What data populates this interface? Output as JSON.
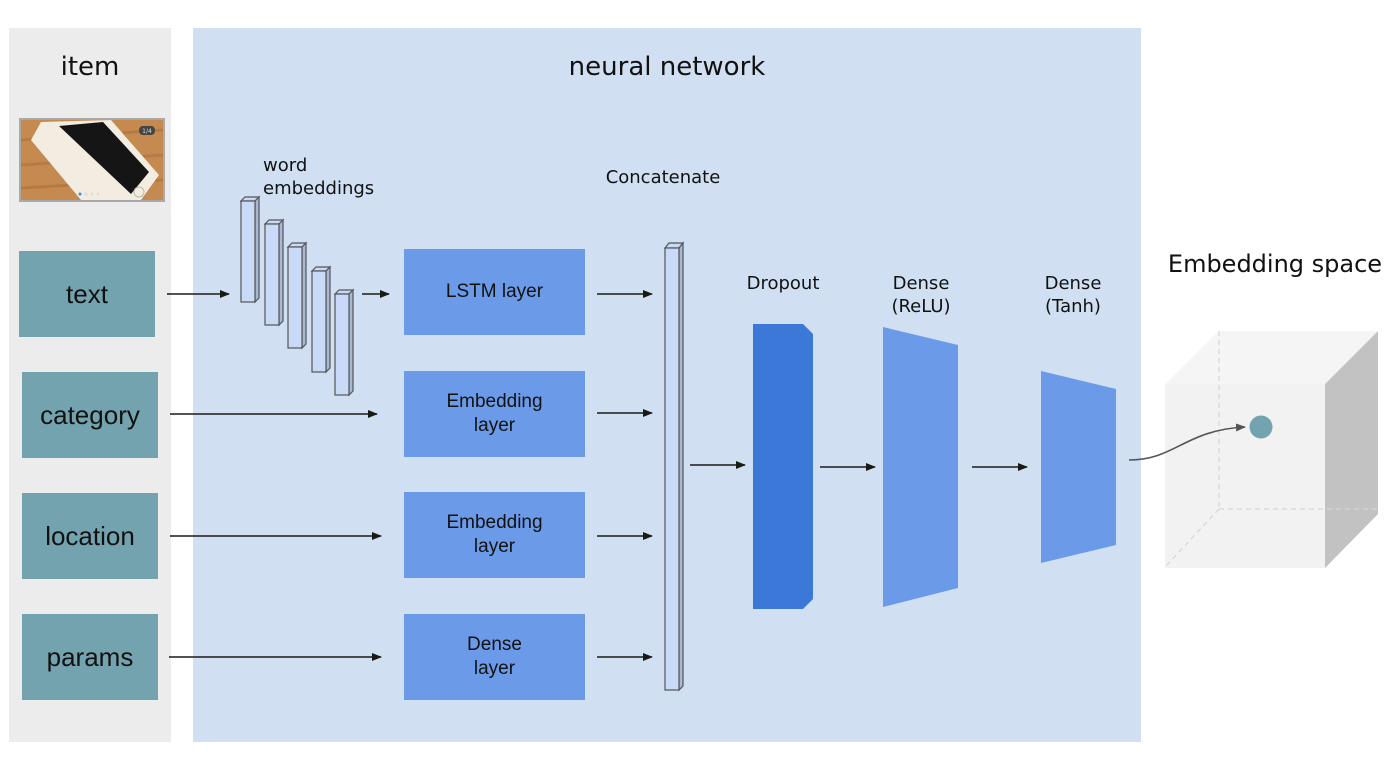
{
  "panels": {
    "item_title": "item",
    "network_title": "neural network",
    "embedding_space_title": "Embedding space"
  },
  "thumbnail": {
    "badge": "1/4",
    "carousel_dots": 4,
    "active_dot": 1
  },
  "inputs": [
    {
      "label": "text"
    },
    {
      "label": "category"
    },
    {
      "label": "location"
    },
    {
      "label": "params"
    }
  ],
  "word_embeddings_label_line1": "word",
  "word_embeddings_label_line2": "embeddings",
  "layers": [
    {
      "line1": "LSTM layer",
      "line2": ""
    },
    {
      "line1": "Embedding",
      "line2": "layer"
    },
    {
      "line1": "Embedding",
      "line2": "layer"
    },
    {
      "line1": "Dense",
      "line2": "layer"
    }
  ],
  "concatenate_label": "Concatenate",
  "dropout_label": "Dropout",
  "dense_relu": {
    "line1": "Dense",
    "line2": "(ReLU)"
  },
  "dense_tanh": {
    "line1": "Dense",
    "line2": "(Tanh)"
  },
  "colors": {
    "item_bg": "#ececec",
    "network_bg": "#d0e0f2",
    "feature_box": "#73a3ae",
    "layer_box": "#6b9be8",
    "dropout": "#3b78d8",
    "vector": "#c9daf8",
    "point": "#73a3ae"
  }
}
